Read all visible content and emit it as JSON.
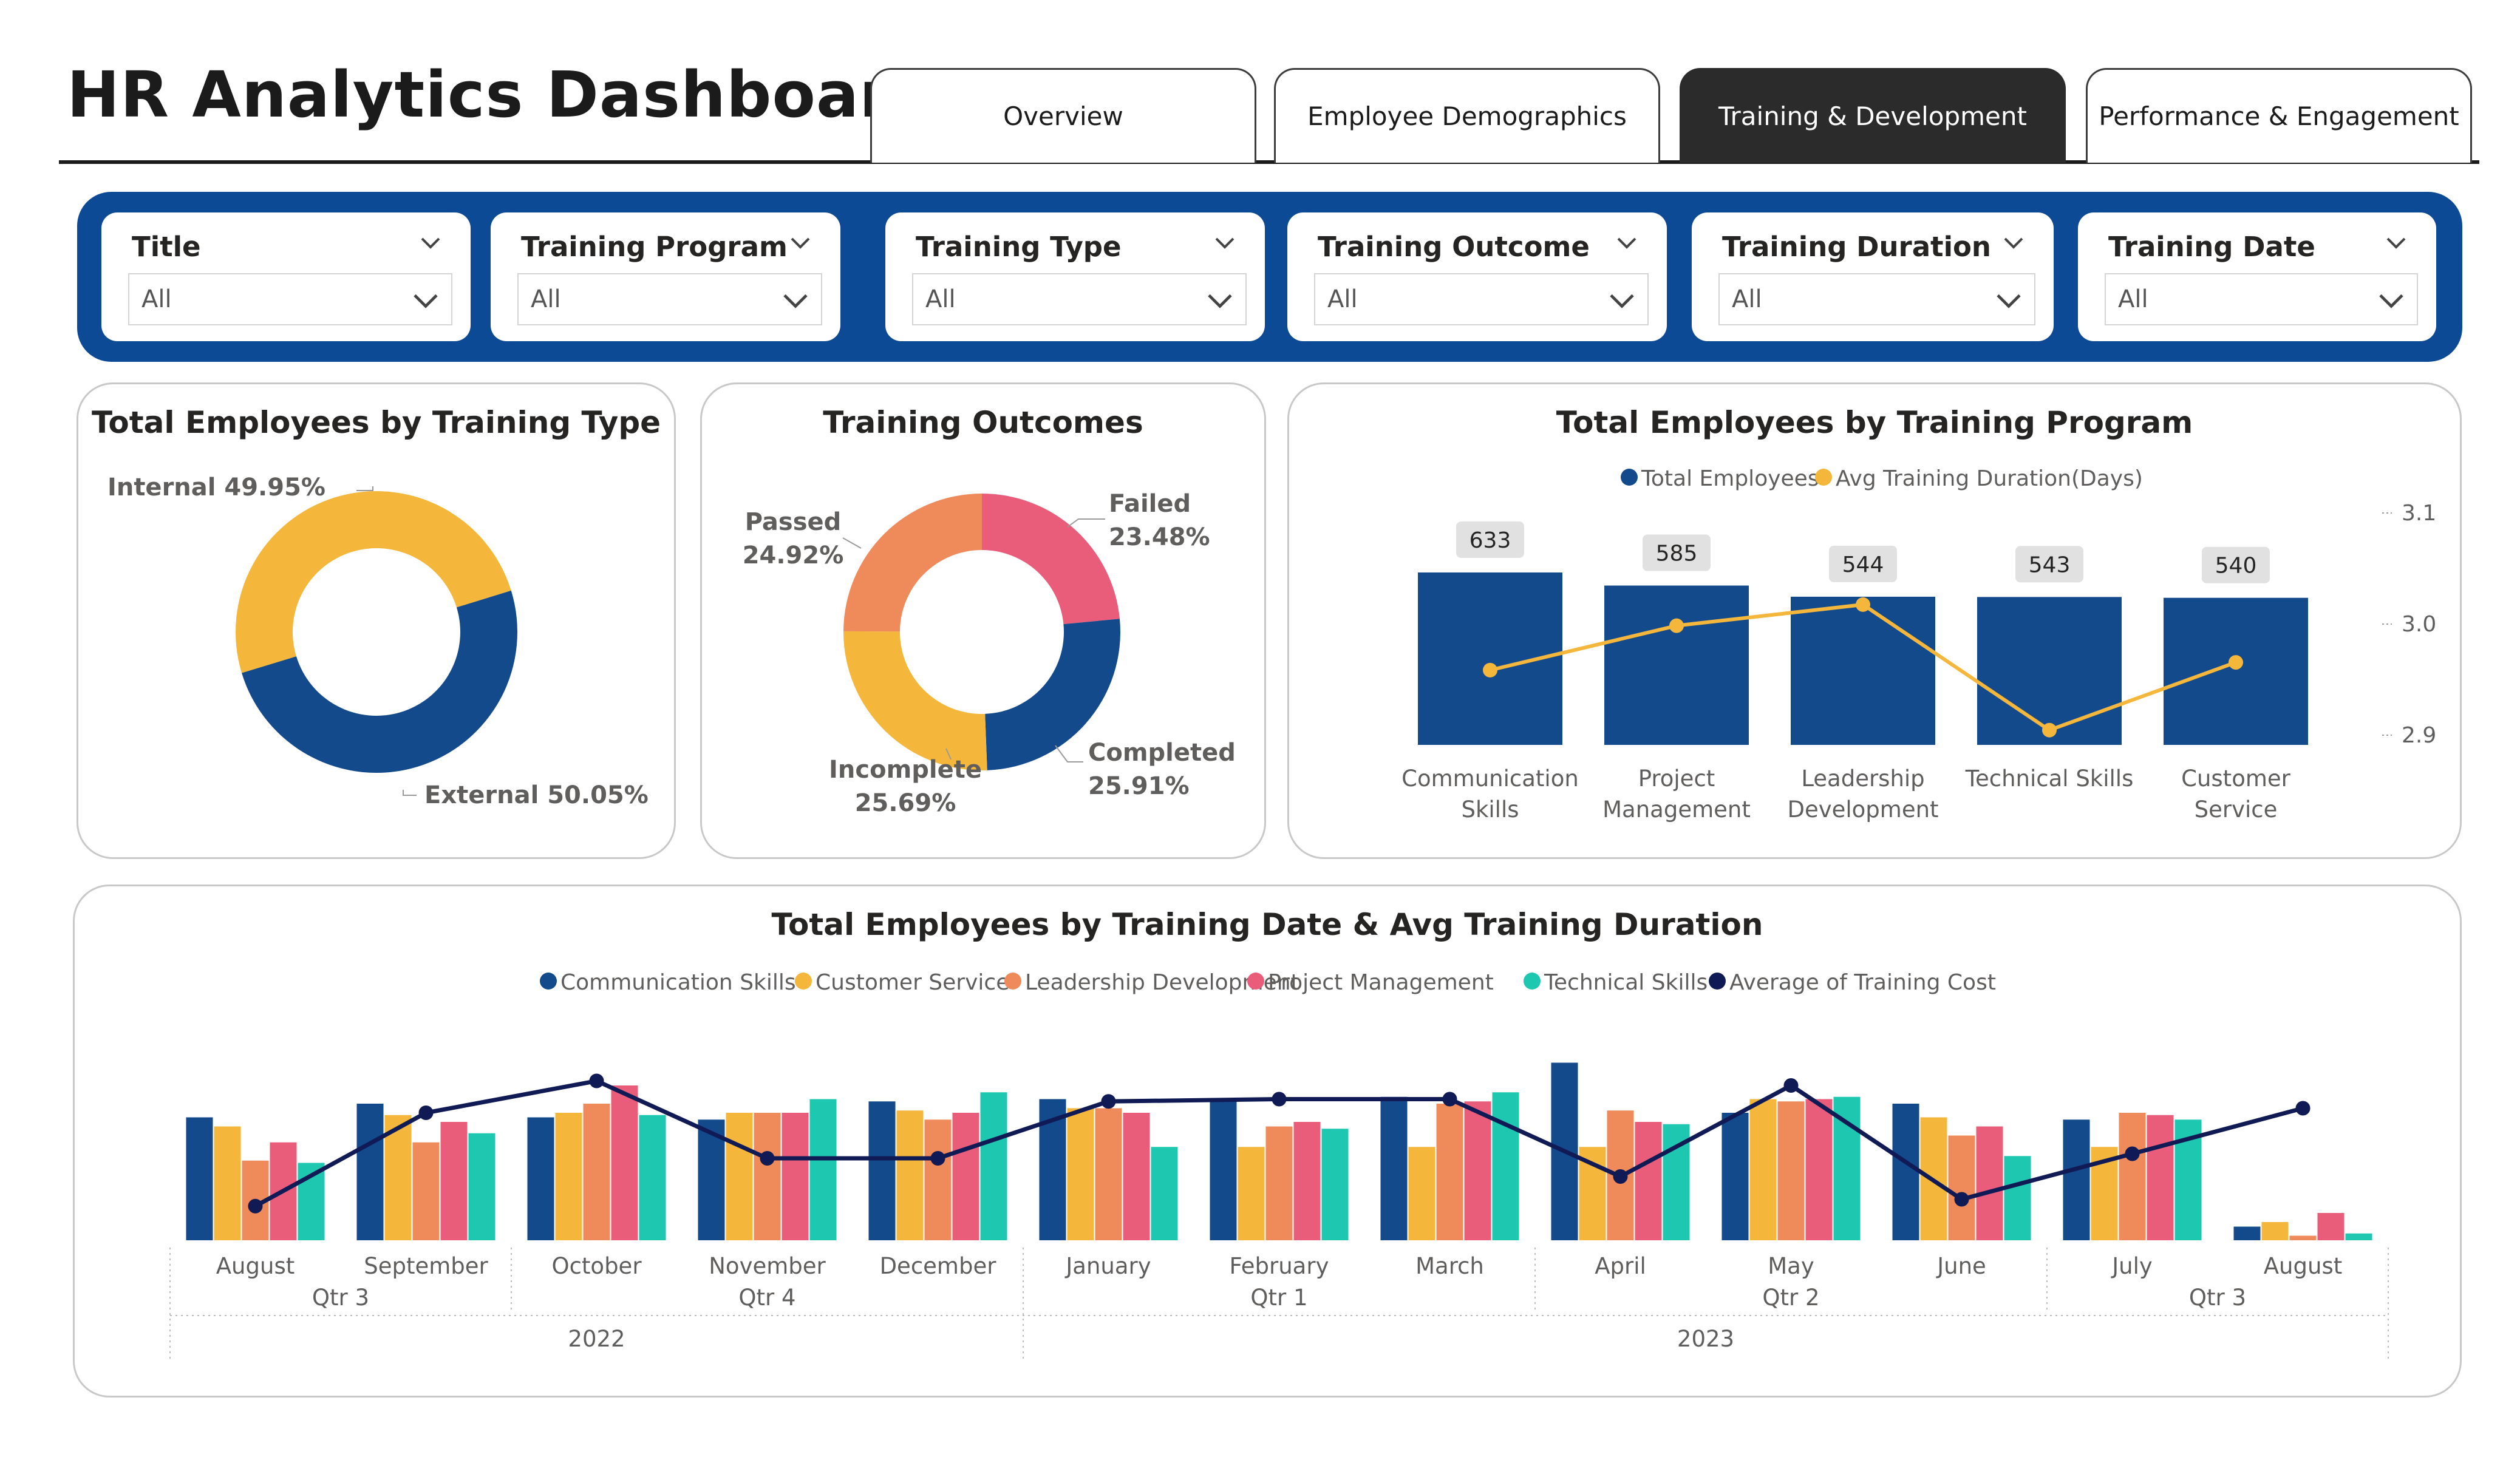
{
  "header": {
    "title": "HR Analytics Dashboard"
  },
  "tabs": [
    {
      "label": "Overview",
      "active": false
    },
    {
      "label": "Employee Demographics",
      "active": false
    },
    {
      "label": "Training & Development",
      "active": true
    },
    {
      "label": "Performance & Engagement",
      "active": false
    }
  ],
  "filters": [
    {
      "label": "Title",
      "value": "All"
    },
    {
      "label": "Training Program",
      "value": "All"
    },
    {
      "label": "Training Type",
      "value": "All"
    },
    {
      "label": "Training Outcome",
      "value": "All"
    },
    {
      "label": "Training Duration",
      "value": "All"
    },
    {
      "label": "Training Date",
      "value": "All"
    }
  ],
  "colors": {
    "navy": "#0d4a96",
    "blue": "#124a8c",
    "yellow": "#f5b73b",
    "orange": "#ef8a5a",
    "pink": "#e95c7a",
    "teal": "#1ec8b0",
    "darknavy": "#101a55",
    "tab_active": "#2b2b2b"
  },
  "chart_data": [
    {
      "type": "pie",
      "variant": "donut",
      "title": "Total Employees by Training Type",
      "slices": [
        {
          "label": "Internal",
          "percent_label": "Internal 49.95%",
          "value": 49.95,
          "color": "#f5b73b"
        },
        {
          "label": "External",
          "percent_label": "External 50.05%",
          "value": 50.05,
          "color": "#124a8c"
        }
      ]
    },
    {
      "type": "pie",
      "variant": "donut",
      "title": "Training Outcomes",
      "slices": [
        {
          "label": "Failed",
          "percent_label": "23.48%",
          "value": 23.48,
          "color": "#e95c7a"
        },
        {
          "label": "Completed",
          "percent_label": "25.91%",
          "value": 25.91,
          "color": "#124a8c"
        },
        {
          "label": "Incomplete",
          "percent_label": "25.69%",
          "value": 25.69,
          "color": "#f5b73b"
        },
        {
          "label": "Passed",
          "percent_label": "24.92%",
          "value": 24.92,
          "color": "#ef8a5a"
        }
      ]
    },
    {
      "type": "bar",
      "title": "Total Employees by Training Program",
      "categories": [
        "Communication Skills",
        "Project Management",
        "Leadership Development",
        "Technical Skills",
        "Customer Service"
      ],
      "series": [
        {
          "name": "Total Employees",
          "values": [
            633,
            585,
            544,
            543,
            540
          ],
          "color": "#124a8c"
        },
        {
          "name": "Avg Training Duration(Days)",
          "type": "line",
          "axis": "right",
          "values": [
            2.964,
            3.004,
            3.023,
            2.91,
            2.971
          ],
          "color": "#f5b73b"
        }
      ],
      "y2_ticks": [
        "3.1",
        "3.0",
        "2.9"
      ],
      "y2lim": [
        2.9,
        3.1
      ],
      "legend": "top-center"
    },
    {
      "type": "bar",
      "title": "Total Employees by Training Date & Avg Training Duration",
      "categories": [
        "August",
        "September",
        "October",
        "November",
        "December",
        "January",
        "February",
        "March",
        "April",
        "May",
        "June",
        "July",
        "August"
      ],
      "quarters": [
        {
          "label": "Qtr 3",
          "span": 2
        },
        {
          "label": "Qtr 4",
          "span": 3
        },
        {
          "label": "Qtr 1",
          "span": 3
        },
        {
          "label": "Qtr 2",
          "span": 3
        },
        {
          "label": "Qtr 3",
          "span": 2
        }
      ],
      "years": [
        {
          "label": "2022",
          "span": 5
        },
        {
          "label": "2023",
          "span": 8
        }
      ],
      "series": [
        {
          "name": "Communication Skills",
          "color": "#124a8c",
          "values": [
            54,
            60,
            54,
            53,
            61,
            62,
            61,
            63,
            78,
            56,
            60,
            53,
            6
          ]
        },
        {
          "name": "Customer Service",
          "color": "#f5b73b",
          "values": [
            50,
            55,
            56,
            56,
            57,
            58,
            41,
            41,
            41,
            62,
            54,
            41,
            8
          ]
        },
        {
          "name": "Leadership Development",
          "color": "#ef8a5a",
          "values": [
            35,
            43,
            60,
            56,
            53,
            58,
            50,
            60,
            57,
            61,
            46,
            56,
            2
          ]
        },
        {
          "name": "Project Management",
          "color": "#e95c7a",
          "values": [
            43,
            52,
            68,
            56,
            56,
            56,
            52,
            61,
            52,
            62,
            50,
            55,
            12
          ]
        },
        {
          "name": "Technical Skills",
          "color": "#1ec8b0",
          "values": [
            34,
            47,
            55,
            62,
            65,
            41,
            49,
            65,
            51,
            63,
            37,
            53,
            3
          ]
        },
        {
          "name": "Average of Training Cost",
          "type": "line",
          "color": "#101a55",
          "values": [
            15,
            56,
            70,
            36,
            36,
            61,
            62,
            62,
            28,
            68,
            18,
            38,
            58
          ]
        }
      ],
      "legend": "top-center"
    }
  ]
}
